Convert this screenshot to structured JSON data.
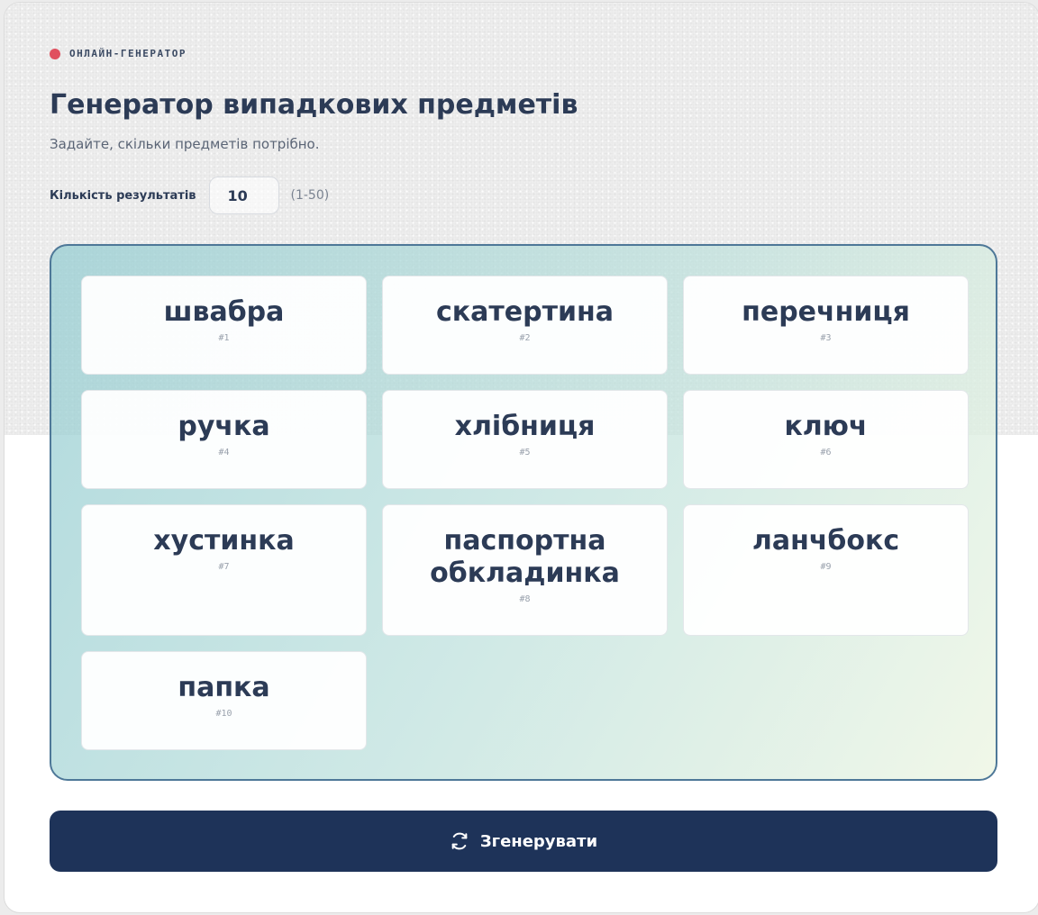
{
  "header": {
    "eyebrow": "ОНЛАЙН-ГЕНЕРАТОР",
    "title": "Генератор випадкових предметів",
    "subtitle": "Задайте, скільки предметів потрібно."
  },
  "controls": {
    "count_label": "Кількість результатів",
    "count_value": "10",
    "count_range": "(1-50)"
  },
  "results": [
    {
      "name": "швабра",
      "num": "#1"
    },
    {
      "name": "скатертина",
      "num": "#2"
    },
    {
      "name": "перечниця",
      "num": "#3"
    },
    {
      "name": "ручка",
      "num": "#4"
    },
    {
      "name": "хлібниця",
      "num": "#5"
    },
    {
      "name": "ключ",
      "num": "#6"
    },
    {
      "name": "хустинка",
      "num": "#7"
    },
    {
      "name": "паспортна обкладинка",
      "num": "#8"
    },
    {
      "name": "ланчбокс",
      "num": "#9"
    },
    {
      "name": "папка",
      "num": "#10"
    }
  ],
  "actions": {
    "generate_label": "Згенерувати",
    "generate_icon": "refresh-icon"
  },
  "colors": {
    "accent_dot": "#e0505f",
    "button_bg": "#1e3359",
    "panel_border": "#4e7898"
  }
}
